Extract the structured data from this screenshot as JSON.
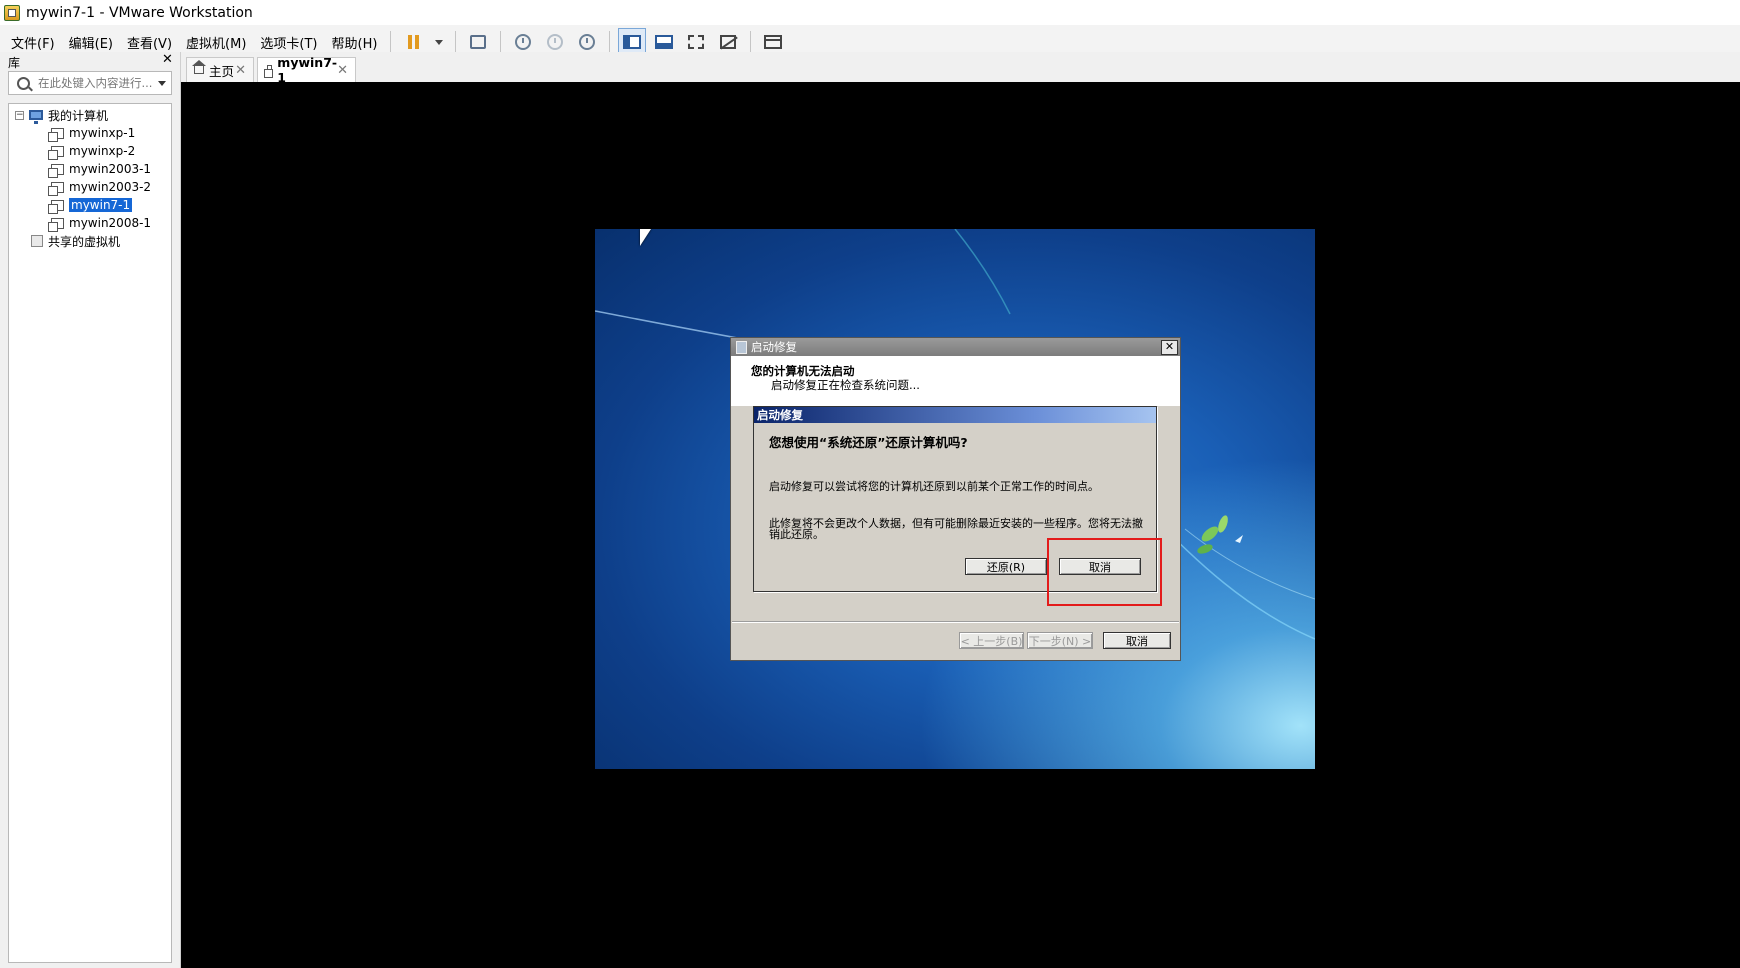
{
  "window": {
    "title": "mywin7-1 - VMware Workstation"
  },
  "menu": {
    "items": [
      "文件(F)",
      "编辑(E)",
      "查看(V)",
      "虚拟机(M)",
      "选项卡(T)",
      "帮助(H)"
    ]
  },
  "library": {
    "header": "库",
    "close": "✕",
    "search_placeholder": "在此处键入内容进行...",
    "root_label": "我的计算机",
    "vms": [
      "mywinxp-1",
      "mywinxp-2",
      "mywin2003-1",
      "mywin2003-2",
      "mywin7-1",
      "mywin2008-1"
    ],
    "selected_vm": "mywin7-1",
    "shared_label": "共享的虚拟机"
  },
  "tabs": [
    {
      "label": "主页",
      "close": "✕"
    },
    {
      "label": "mywin7-1",
      "close": "✕"
    }
  ],
  "guest": {
    "outer_dialog": {
      "title": "启动修复",
      "close": "✕",
      "heading": "您的计算机无法启动",
      "subtext": "启动修复正在检查系统问题...",
      "back_button": "< 上一步(B)",
      "next_button": "下一步(N) >",
      "cancel_button": "取消"
    },
    "inner_dialog": {
      "title": "启动修复",
      "question": "您想使用“系统还原”还原计算机吗?",
      "paragraph1": "启动修复可以尝试将您的计算机还原到以前某个正常工作的时间点。",
      "paragraph2": "此修复将不会更改个人数据，但有可能删除最近安装的一些程序。您将无法撤销此还原。",
      "restore_button": "还原(R)",
      "cancel_button": "取消"
    }
  },
  "colors": {
    "highlight": "#e31b1b",
    "selection": "#1567d6",
    "pause": "#e29a20"
  }
}
